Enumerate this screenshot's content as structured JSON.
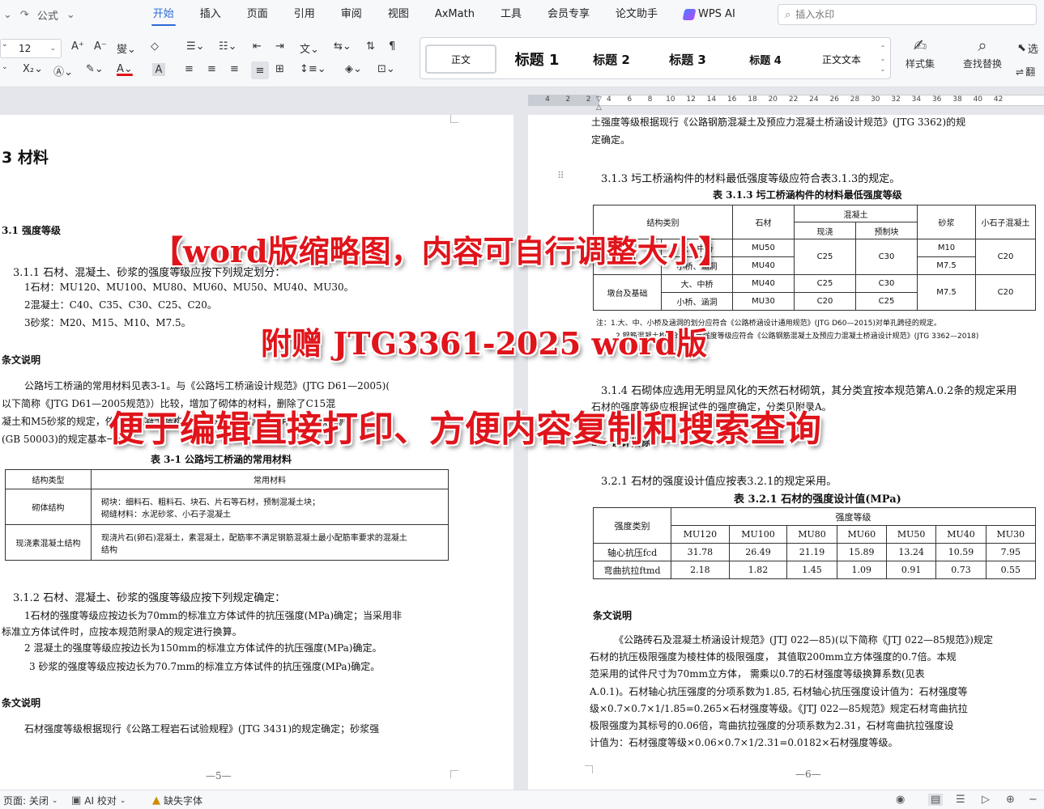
{
  "menubar": {
    "quick_label": "公式",
    "tabs": [
      {
        "label": "开始",
        "active": true
      },
      {
        "label": "插入"
      },
      {
        "label": "页面"
      },
      {
        "label": "引用"
      },
      {
        "label": "审阅"
      },
      {
        "label": "视图"
      },
      {
        "label": "AxMath"
      },
      {
        "label": "工具"
      },
      {
        "label": "会员专享"
      },
      {
        "label": "论文助手"
      },
      {
        "label": "WPS AI"
      }
    ],
    "search_placeholder": "插入水印"
  },
  "ribbon": {
    "font_size": "12",
    "styles": [
      "正文",
      "标题 1",
      "标题 2",
      "标题 3",
      "标题 4",
      "正文文本"
    ],
    "style_set_label": "样式集",
    "find_replace_label": "查找替换",
    "select_label": "选",
    "translate_label": "翻"
  },
  "ruler": {
    "numbers": [
      "4",
      "2",
      "2",
      "4",
      "6",
      "8",
      "10",
      "12",
      "14",
      "16",
      "18",
      "20",
      "22",
      "24",
      "26",
      "28",
      "30",
      "32",
      "34",
      "36",
      "38",
      "40",
      "42"
    ]
  },
  "left_page": {
    "chapter": "3  材料",
    "sec_3_1": "3.1  强度等级",
    "c311_num": "3.1.1",
    "c311_text": "石材、混凝土、砂浆的强度等级应按下列规定划分：",
    "c311_items": [
      "1石材：MU120、MU100、MU80、MU60、MU50、MU40、MU30。",
      "2混凝土：C40、C35、C30、C25、C20。",
      "3砂浆：M20、M15、M10、M7.5。"
    ],
    "note_title_1": "条文说明",
    "note1_lines": [
      "公路圬工桥涵的常用材料见表3-1。与《公路圬工桥涵设计规范》(JTG D61—2005)(",
      "以下简称《JTG D61—2005规范》）比较，增加了砌体的材料，删除了C15混",
      "凝土和M5砂浆的规定，依据《混凝土结构耐久性设计标准》规定并参照《规范》",
      "(GB 50003)的规定基本一致。"
    ],
    "table31_title": "表 3-1 公路圬工桥涵的常用材料",
    "table31_header": [
      "结构类型",
      "常用材料"
    ],
    "table31_rows": [
      {
        "type": "砌体结构",
        "line1": "砌块：细料石、粗料石、块石、片石等石材，预制混凝土块；",
        "line2": "砌缝材料：水泥砂浆、小石子混凝土"
      },
      {
        "type": "现浇素混凝土结构",
        "line1": "现浇片石(卵石)混凝土，素混凝土，配筋率不满足钢筋混凝土最小配筋率要求的混凝土",
        "line2": "结构"
      }
    ],
    "c312_num": "3.1.2",
    "c312_text": "石材、混凝土、砂浆的强度等级应按下列规定确定：",
    "c312_lines": [
      "1石材的强度等级应按边长为70mm的标准立方体试件的抗压强度(MPa)确定；当采用非",
      "标准立方体试件时，应按本规范附录A的规定进行换算。",
      "2 混凝土的强度等级应按边长为150mm的标准立方体试件的抗压强度(MPa)确定。",
      "3 砂浆的强度等级应按边长为70.7mm的标准立方体试件的抗压强度(MPa)确定。"
    ],
    "note_title_2": "条文说明",
    "note2_line": "石材强度等级根据现行《公路工程岩石试验规程》(JTG 3431)的规定确定；砂浆强",
    "page_number": "—5—"
  },
  "right_page": {
    "top_lines": [
      "土强度等级根据现行《公路钢筋混凝土及预应力混凝土桥涵设计规范》(JTG 3362)的规",
      "定确定。"
    ],
    "c313_num": "3.1.3",
    "c313_text": "圬工桥涵构件的材料最低强度等级应符合表3.1.3的规定。",
    "table313_title": "表 3.1.3 圬工桥涵构件的材料最低强度等级",
    "table313_header": {
      "structure": "结构类别",
      "stone": "石材",
      "concrete": "混凝土",
      "cast": "现浇",
      "precast": "预制块",
      "mortar": "砂浆",
      "small_concrete": "小石子混凝土"
    },
    "table313_rows": [
      {
        "group": "拱圈",
        "sub": "大、中桥",
        "stone": "MU50",
        "cast": "C25",
        "precast": "C30",
        "mortar": "M10",
        "small": "C20"
      },
      {
        "group": "",
        "sub": "小桥、涵洞",
        "stone": "MU40",
        "cast": "C25",
        "precast": "C30",
        "mortar": "M7.5",
        "small": ""
      },
      {
        "group": "墩台及基础",
        "sub": "大、中桥",
        "stone": "MU40",
        "cast": "C25",
        "precast": "C30",
        "mortar": "M7.5",
        "small": "C20"
      },
      {
        "group": "",
        "sub": "小桥、涵洞",
        "stone": "MU30",
        "cast": "C20",
        "precast": "C25",
        "mortar": "",
        "small": ""
      }
    ],
    "table313_notes": [
      "注：1.大、中、小桥及涵洞的划分应符合《公路桥涵设计通用规范》(JTG D60—2015)对单孔跨径的规定。",
      "2.钢筋混凝土构件的混凝土强度等级应符合《公路钢筋混凝土及预应力混凝土桥涵设计规范》(JTG 3362—2018)"
    ],
    "c314_num": "3.1.4",
    "c314_line1": "石砌体应选用无明显风化的天然石材砌筑，其分类宜按本规范第A.0.2条的规定采用",
    "c314_line2": "石材的强度等级应根据试件的强度确定，分类见附录A。",
    "sec_3_2": "3.2  设计指标",
    "c321_num": "3.2.1",
    "c321_text": "石材的强度设计值应按表3.2.1的规定采用。",
    "table321_title": "表 3.2.1  石材的强度设计值(MPa)",
    "table321_header": {
      "type": "强度类别",
      "grade": "强度等级",
      "grades": [
        "MU120",
        "MU100",
        "MU80",
        "MU60",
        "MU50",
        "MU40",
        "MU30"
      ]
    },
    "table321_rows": [
      {
        "label": "轴心抗压fcd",
        "values": [
          "31.78",
          "26.49",
          "21.19",
          "15.89",
          "13.24",
          "10.59",
          "7.95"
        ]
      },
      {
        "label": "弯曲抗拉ftmd",
        "values": [
          "2.18",
          "1.82",
          "1.45",
          "1.09",
          "0.91",
          "0.73",
          "0.55"
        ]
      }
    ],
    "note_title": "条文说明",
    "note_lines": [
      "《公路砖石及混凝土桥涵设计规范》(JTJ 022—85)(以下简称《JTJ 022—85规范》)规定",
      "石材的抗压极限强度为棱柱体的极限强度， 其值取200mm立方体强度的0.7倍。本规",
      "范采用的试件尺寸为70mm立方体， 需乘以0.7的石材强度等级换算系数(见表",
      "A.0.1)。石材轴心抗压强度的分项系数为1.85, 石材轴心抗压强度设计值为：石材强度等",
      "级×0.7×0.7×1/1.85=0.265×石材强度等级。《JTJ 022—85规范》规定石材弯曲抗拉",
      "极限强度为其标号的0.06倍，弯曲抗拉强度的分项系数为2.31，石材弯曲抗拉强度设",
      "计值为：石材强度等级×0.06×0.7×1/2.31=0.0182×石材强度等级。"
    ],
    "page_number": "—6—"
  },
  "overlays": {
    "line1": "【word版缩略图，内容可自行调整大小】",
    "line2": "附赠  JTG3361-2025 word版",
    "line3": "便于编辑直接打印、方便内容复制和搜索查询"
  },
  "statusbar": {
    "protect": "页面: 关闭",
    "ai_check": "AI 校对",
    "missing_font": "缺失字体"
  },
  "colors": {
    "accent": "#2b6bd6",
    "overlay_red": "#e0141b",
    "page_bg": "#ffffff",
    "canvas_bg": "#e4e6eb"
  }
}
